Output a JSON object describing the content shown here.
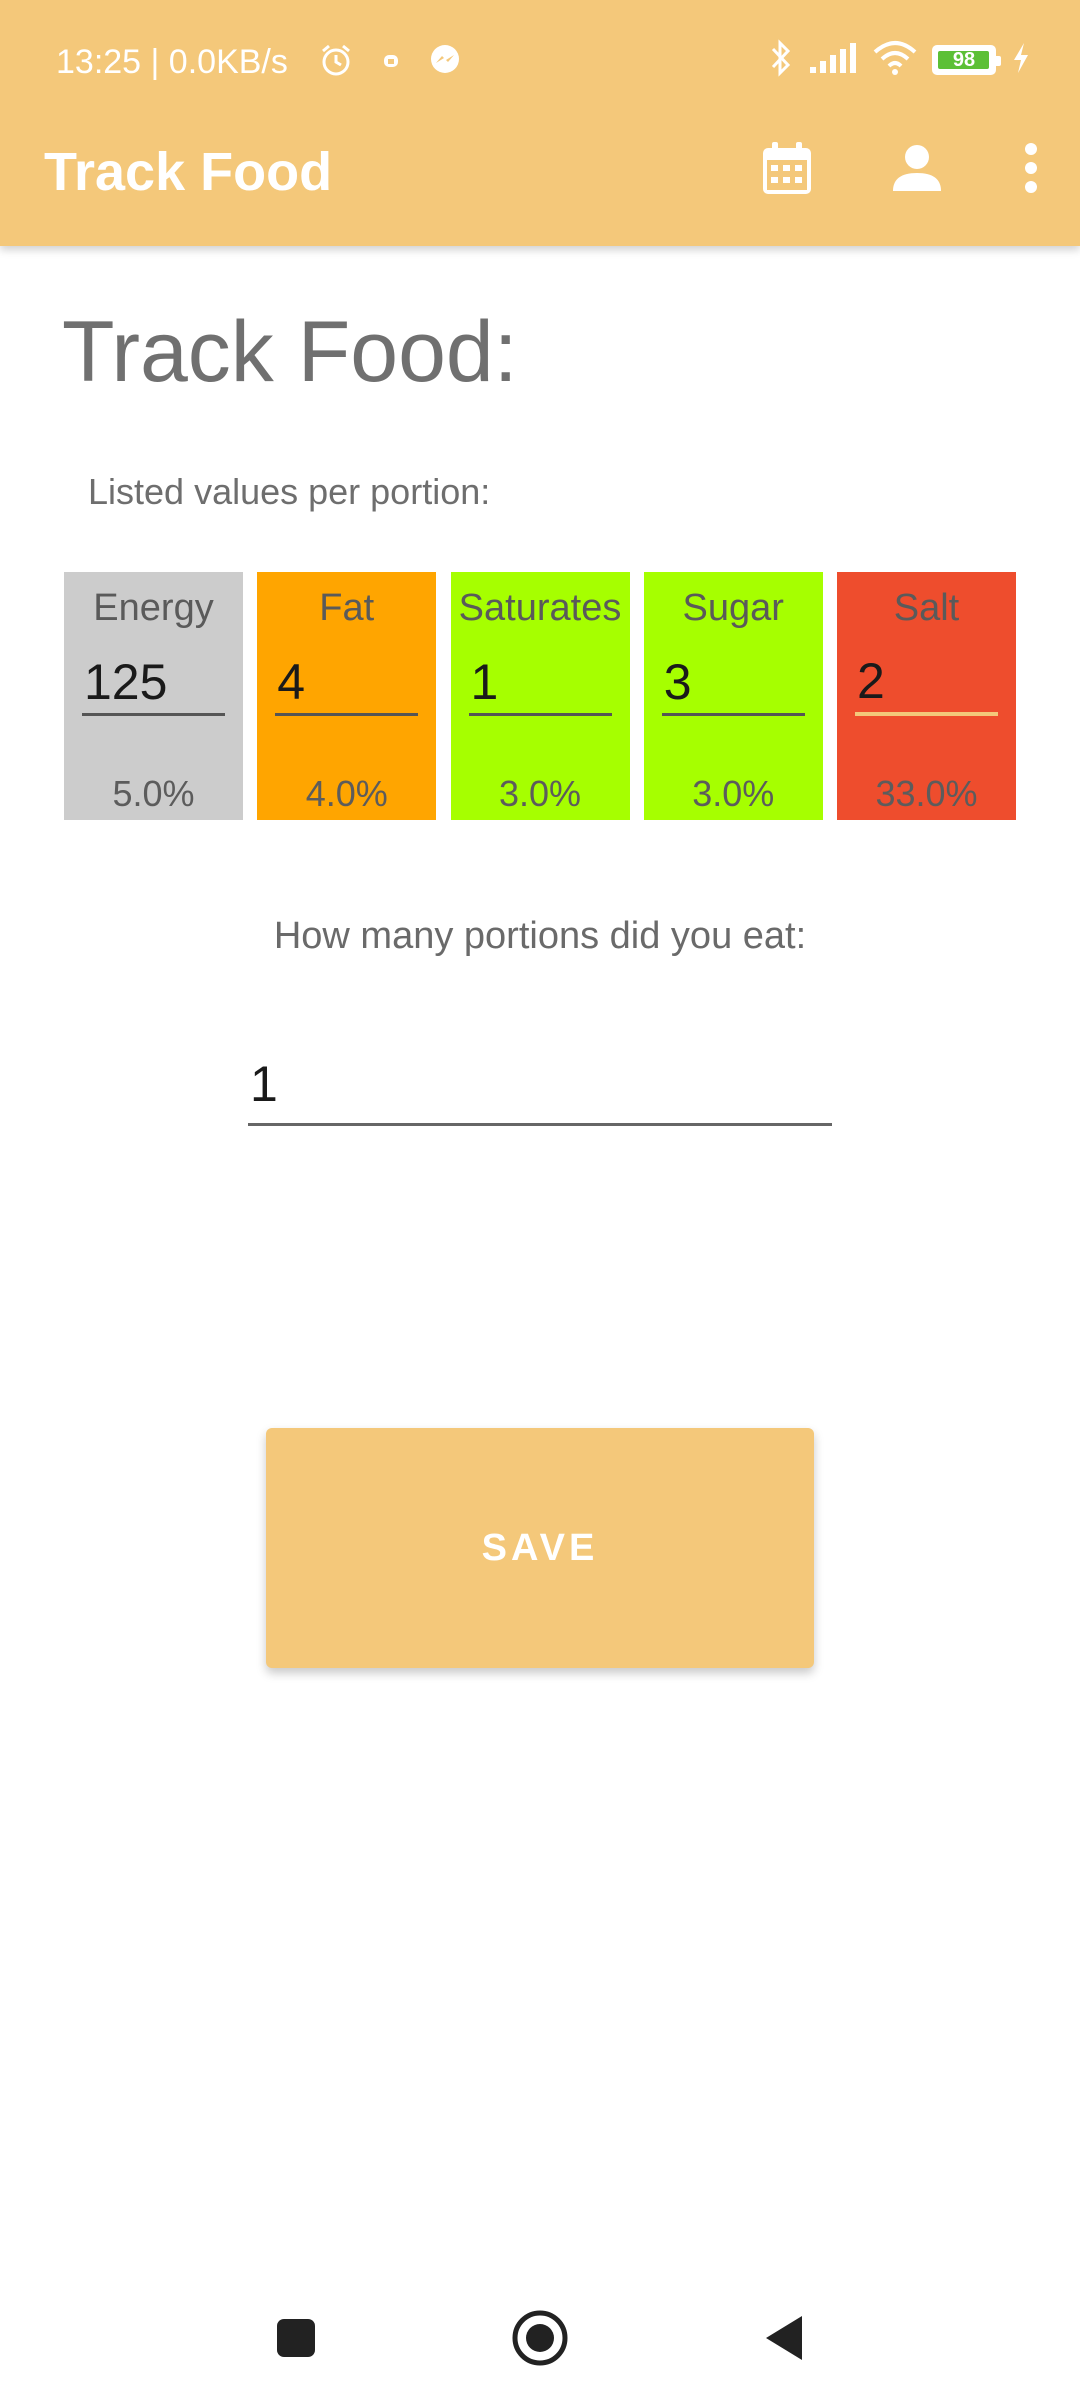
{
  "status_bar": {
    "time_speed": "13:25 | 0.0KB/s",
    "battery": "98",
    "battery_level": 0.98,
    "left_icons": [
      "alarm-icon",
      "notification-icon",
      "messenger-icon"
    ],
    "right_icons": [
      "bluetooth-icon",
      "signal-icon",
      "wifi-icon",
      "battery-icon",
      "charging-icon"
    ]
  },
  "app_bar": {
    "title": "Track Food",
    "actions": [
      "calendar-icon",
      "person-icon",
      "more-vert-icon"
    ]
  },
  "page": {
    "title": "Track Food:",
    "subtitle": "Listed values per portion:",
    "nutrients": [
      {
        "label": "Energy",
        "value": "125",
        "percent": "5.0%",
        "color": "#CCCCCC"
      },
      {
        "label": "Fat",
        "value": "4",
        "percent": "4.0%",
        "color": "#FFA500"
      },
      {
        "label": "Saturates",
        "value": "1",
        "percent": "3.0%",
        "color": "#A6FF00"
      },
      {
        "label": "Sugar",
        "value": "3",
        "percent": "3.0%",
        "color": "#A6FF00"
      },
      {
        "label": "Salt",
        "value": "2",
        "percent": "33.0%",
        "color": "#EE4D2D"
      }
    ],
    "portions_label": "How many portions did you eat:",
    "portions_value": "1",
    "save_label": "SAVE"
  },
  "colors": {
    "primary": "#F4C87A",
    "text_gray": "#707070"
  },
  "nav_bar": [
    "recents-icon",
    "home-icon",
    "back-icon"
  ]
}
